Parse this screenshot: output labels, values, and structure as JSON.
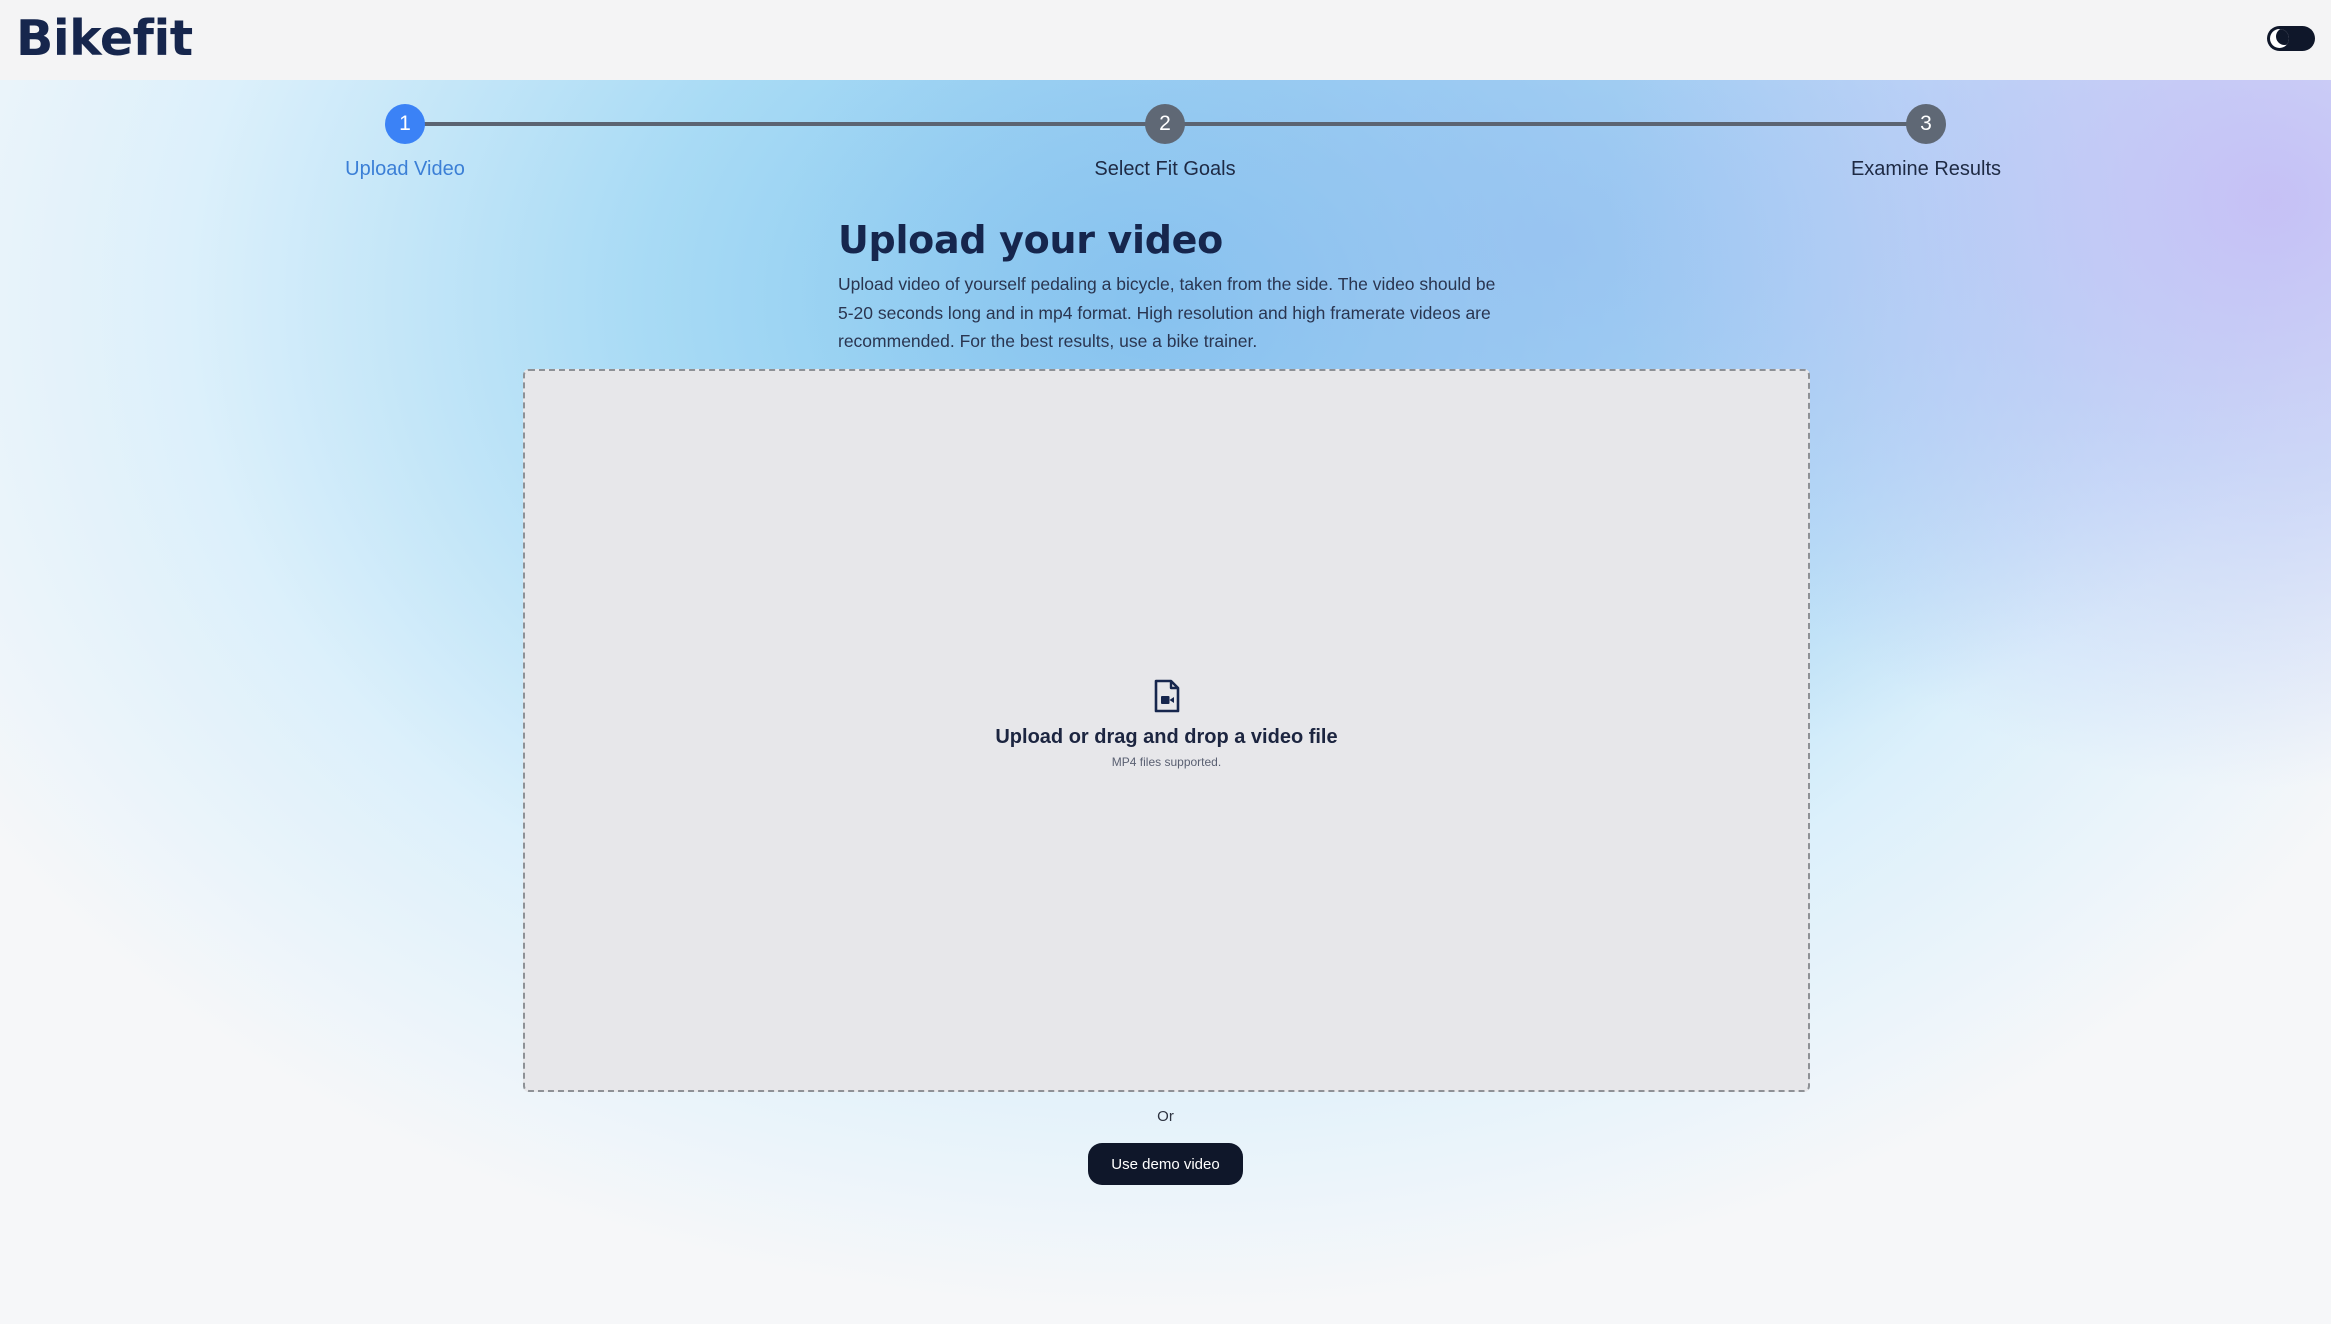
{
  "header": {
    "logo": "Bikefit",
    "theme_toggle_icon": "dark-mode-toggle-icon"
  },
  "stepper": {
    "steps": [
      {
        "number": "1",
        "label": "Upload Video",
        "active": true
      },
      {
        "number": "2",
        "label": "Select Fit Goals",
        "active": false
      },
      {
        "number": "3",
        "label": "Examine Results",
        "active": false
      }
    ]
  },
  "main": {
    "title": "Upload your video",
    "description": "Upload video of yourself pedaling a bicycle, taken from the side. The video should be 5-20 seconds long and in mp4 format. High resolution and high framerate videos are recommended. For the best results, use a bike trainer.",
    "dropzone": {
      "icon": "video-file-icon",
      "title": "Upload or drag and drop a video file",
      "subtitle": "MP4 files supported."
    },
    "or_text": "Or",
    "demo_button": "Use demo video"
  },
  "colors": {
    "accent": "#3b82f6",
    "brand_dark": "#16264d",
    "inactive_step": "#5f6875",
    "button_bg": "#0f172a"
  }
}
